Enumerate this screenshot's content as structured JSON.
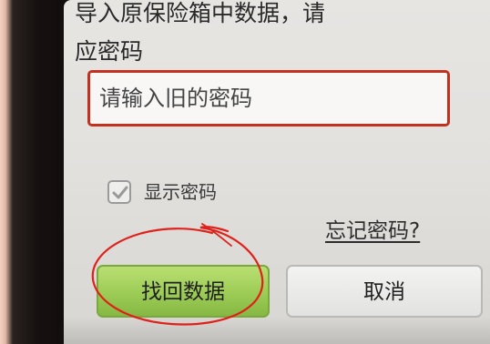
{
  "dialog": {
    "message_line1": "导入原保险箱中数据，请",
    "message_line2": "应密码",
    "password_placeholder": "请输入旧的密码",
    "show_password_label": "显示密码",
    "show_password_checked": true,
    "forgot_password_link": "忘记密码?",
    "recover_button": "找回数据",
    "cancel_button": "取消"
  },
  "colors": {
    "input_border": "#c2311f",
    "recover_button": "#9ccc55",
    "annotation_circle": "#e0201a"
  }
}
